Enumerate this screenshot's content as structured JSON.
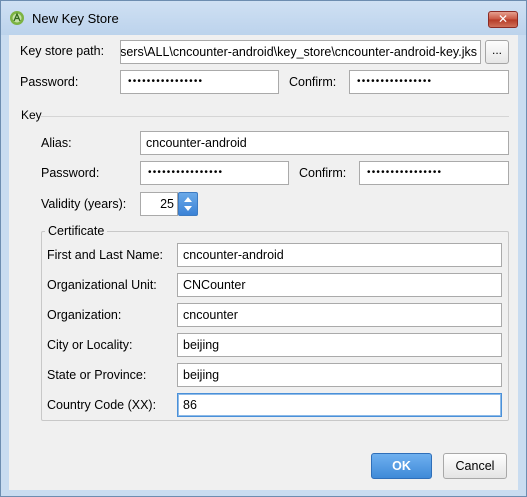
{
  "window": {
    "title": "New Key Store",
    "close_label": "✕"
  },
  "keystore": {
    "path_label": "Key store path:",
    "path_value": "C:\\Users\\ALL\\cncounter-android\\key_store\\cncounter-android-key.jks",
    "browse_label": "...",
    "password_label": "Password:",
    "password_value": "••••••••••••••••",
    "confirm_label": "Confirm:",
    "confirm_value": "••••••••••••••••"
  },
  "key": {
    "section_title": "Key",
    "alias_label": "Alias:",
    "alias_value": "cncounter-android",
    "password_label": "Password:",
    "password_value": "••••••••••••••••",
    "confirm_label": "Confirm:",
    "confirm_value": "••••••••••••••••",
    "validity_label": "Validity (years):",
    "validity_value": "25"
  },
  "certificate": {
    "title": "Certificate",
    "fields": [
      {
        "label": "First and Last Name:",
        "value": "cncounter-android"
      },
      {
        "label": "Organizational Unit:",
        "value": "CNCounter"
      },
      {
        "label": "Organization:",
        "value": "cncounter"
      },
      {
        "label": "City or Locality:",
        "value": "beijing"
      },
      {
        "label": "State or Province:",
        "value": "beijing"
      },
      {
        "label": "Country Code (XX):",
        "value": "86"
      }
    ]
  },
  "buttons": {
    "ok": "OK",
    "cancel": "Cancel"
  },
  "colors": {
    "accent": "#3f8ad8",
    "title_bar": "#bcd3ec",
    "close": "#c9533f"
  }
}
